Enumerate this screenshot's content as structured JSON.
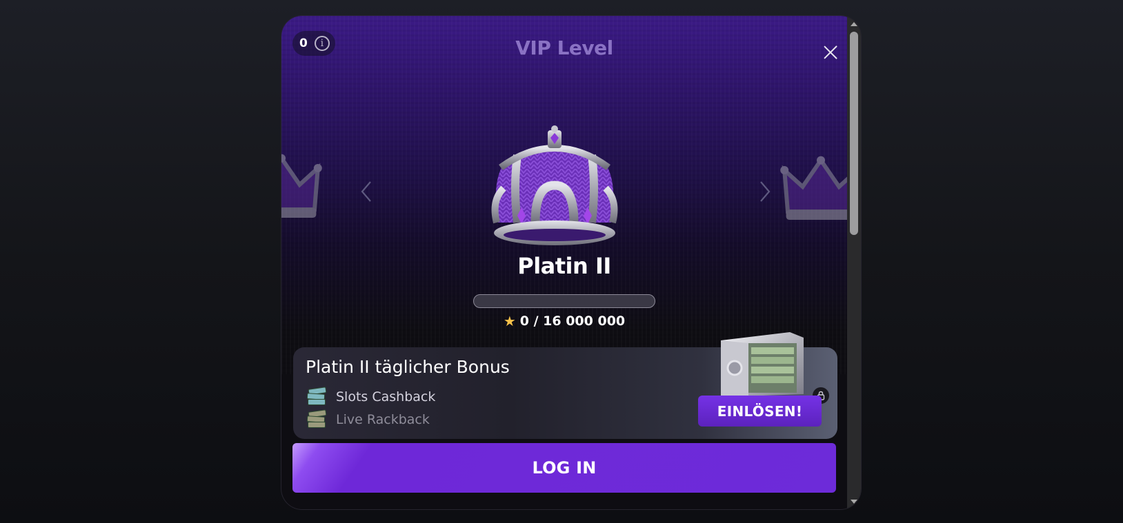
{
  "header": {
    "counter_value": "0",
    "info_icon": "info-icon",
    "title": "VIP Level",
    "close_icon": "close-icon"
  },
  "carousel": {
    "prev_icon": "chevron-left-icon",
    "next_icon": "chevron-right-icon",
    "current_image": "crown-icon"
  },
  "level": {
    "name": "Platin II",
    "progress": 0,
    "points_icon": "star-icon",
    "points_text": "0 / 16 000 000"
  },
  "bonus": {
    "title": "Platin II täglicher Bonus",
    "items": [
      {
        "icon": "cash-icon",
        "label": "Slots Cashback"
      },
      {
        "icon": "cash-icon",
        "label": "Live Rackback"
      }
    ],
    "image": "safe-icon",
    "lock_icon": "lock-icon",
    "redeem_label": "EINLÖSEN!"
  },
  "actions": {
    "login_label": "LOG IN"
  },
  "colors": {
    "accent": "#6e2bd9",
    "progress_fill": "#b584ff",
    "title": "#8a72c4"
  }
}
